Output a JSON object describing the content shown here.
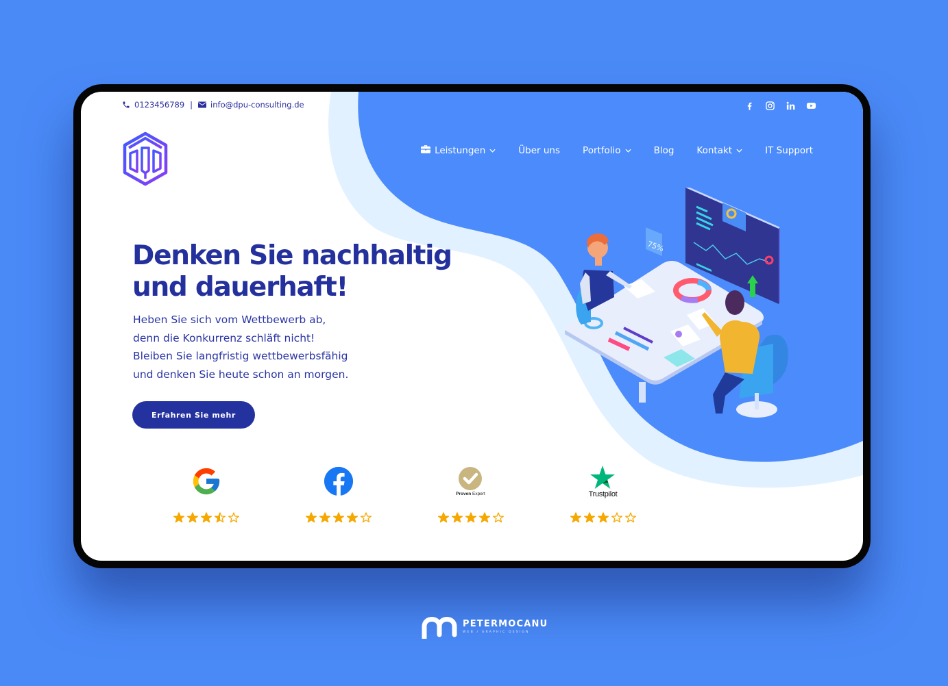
{
  "contact": {
    "phone": "0123456789",
    "separator": "|",
    "email": "info@dpu-consulting.de"
  },
  "social": [
    {
      "name": "facebook-icon"
    },
    {
      "name": "instagram-icon"
    },
    {
      "name": "linkedin-icon"
    },
    {
      "name": "youtube-icon"
    }
  ],
  "nav": {
    "items": [
      {
        "label": "Leistungen",
        "icon": "briefcase-icon",
        "dropdown": true
      },
      {
        "label": "Über uns",
        "dropdown": false
      },
      {
        "label": "Portfolio",
        "dropdown": true
      },
      {
        "label": "Blog",
        "dropdown": false
      },
      {
        "label": "Kontakt",
        "dropdown": true
      },
      {
        "label": "IT Support",
        "dropdown": false
      }
    ]
  },
  "hero": {
    "headline_line1": "Denken Sie nachhaltig",
    "headline_line2": "und dauerhaft!",
    "sub_lines": [
      "Heben Sie sich vom Wettbewerb ab,",
      "denn die Konkurrenz schläft nicht!",
      "Bleiben Sie langfristig wettbewerbsfähig",
      "und denken Sie heute schon an morgen."
    ],
    "cta_label": "Erfahren Sie mehr",
    "illustration_badge": "75%"
  },
  "ratings": [
    {
      "platform": "Google",
      "stars": 3.5,
      "max": 5
    },
    {
      "platform": "Facebook",
      "stars": 4,
      "max": 5
    },
    {
      "platform": "Proven Expert",
      "label_bold": "Proven",
      "label_rest": " Expert",
      "stars": 4,
      "max": 5
    },
    {
      "platform": "Trustpilot",
      "label": "Trustpilot",
      "stars": 3,
      "max": 5
    }
  ],
  "colors": {
    "background": "#4a8af7",
    "accent_blue": "#4b8bfb",
    "light_blue": "#e1f1ff",
    "headline": "#24319d",
    "cta": "#24329f",
    "star": "#f5a800"
  },
  "brand": {
    "name": "PETERMOCANU",
    "tagline": "WEB / GRAPHIC DESIGN"
  }
}
